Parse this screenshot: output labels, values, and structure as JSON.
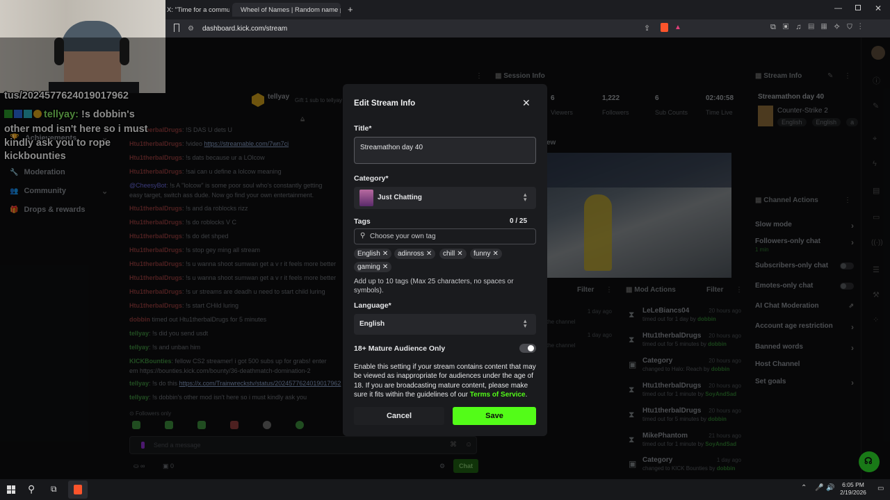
{
  "browser": {
    "tab1_title": "X: \"Time for a commu",
    "tab2_title": "Wheel of Names | Random name pick",
    "url": "dashboard.kick.com/stream"
  },
  "overlay_chat": {
    "line1": "tus/2024577624019017962",
    "username": "tellyay",
    "msg_l1": "!s dobbin's",
    "msg_l2": "other mod isn't here so i must",
    "msg_l3": "kindly ask you to rope",
    "msg_l4": "kickbounties"
  },
  "sidebar": {
    "items": [
      "Achievements",
      "Moderation",
      "Community",
      "Drops & rewards"
    ]
  },
  "chat": {
    "header_user": "tellyay",
    "header_sub": "Gift 1 sub to tellyay",
    "lines": [
      {
        "user": "Htu1therbalDrugs",
        "text": ": !S DAS U dets U"
      },
      {
        "user": "Htu1therbalDrugs",
        "text": ": !video ",
        "link": "https://streamable.com/7wn7ci"
      },
      {
        "user": "Htu1therbalDrugs",
        "text": ": !s dats because ur a LOlcow"
      },
      {
        "user": "Htu1therbalDrugs",
        "text": ": !sai can u define a lolcow meaning"
      },
      {
        "user": "@CheesyBot",
        "text": ": !s A \"lolcow\" is some poor soul who's constantly getting"
      },
      {
        "user": "",
        "text": "easy target, switch ass dude. Now go find your own entertainment."
      },
      {
        "user": "Htu1therbalDrugs",
        "text": ": !s and da roblocks rizz"
      },
      {
        "user": "Htu1therbalDrugs",
        "text": ": !s do roblocks V C"
      },
      {
        "user": "Htu1therbalDrugs",
        "text": ": !s do det shped"
      },
      {
        "user": "Htu1therbalDrugs",
        "text": ": !s stop gey ming all stream"
      },
      {
        "user": "Htu1therbalDrugs",
        "text": ": !s u wanna shoot sumwan get a v r it feels more better"
      },
      {
        "user": "Htu1therbalDrugs",
        "text": ": !s u wanna shoot sumwan get a v r it feels more better"
      },
      {
        "user": "Htu1therbalDrugs",
        "text": ": !s ur streams are deadh u need to start child luring"
      },
      {
        "user": "Htu1therbalDrugs",
        "text": ": !s start CHild luring"
      },
      {
        "user": "dobbin",
        "text": " timed out Htu1therbalDrugs for 5 minutes"
      },
      {
        "user": "tellyay",
        "text": ": !s did you send usdt"
      },
      {
        "user": "tellyay",
        "text": ": !s and unban him"
      },
      {
        "user": "KICKBounties",
        "text": ": fellow CS2 streamer! i got 500 subs up for grabs! enter"
      },
      {
        "user": "",
        "text": "em https://bounties.kick.com/bounty/36-deathmatch-domination-2"
      },
      {
        "user": "tellyay",
        "text": ": !s do this ",
        "link": "https://x.com/Trainwreckstv/status/2024577624019017962"
      },
      {
        "user": "tellyay",
        "text": ": !s dobbin's other mod isn't here so i must kindly ask you"
      }
    ],
    "followers_only": "Followers only",
    "send_placeholder": "Send a message",
    "count_left": "0",
    "count_right": "0",
    "chat_button": "Chat"
  },
  "session_info": {
    "title": "Session Info",
    "stats": [
      {
        "value": "6",
        "label": "Viewers"
      },
      {
        "value": "1,222",
        "label": "Followers"
      },
      {
        "value": "6",
        "label": "Sub Counts"
      },
      {
        "value": "02:40:58",
        "label": "Time Live"
      }
    ],
    "preview_label": "ew"
  },
  "stream_info_panel": {
    "title": "Stream Info",
    "stream_title": "Streamathon day 40",
    "category": "Counter-Strike 2",
    "tags": [
      "English",
      "English",
      "a"
    ]
  },
  "channel_actions": {
    "title": "Channel Actions",
    "items": [
      {
        "label": "Slow mode",
        "sub": ""
      },
      {
        "label": "Followers-only chat",
        "sub": "1 min"
      },
      {
        "label": "Subscribers-only chat",
        "sub": ""
      },
      {
        "label": "Emotes-only chat",
        "sub": ""
      },
      {
        "label": "AI Chat Moderation",
        "sub": ""
      },
      {
        "label": "Account age restriction",
        "sub": ""
      },
      {
        "label": "Banned words",
        "sub": ""
      },
      {
        "label": "Host Channel",
        "sub": ""
      },
      {
        "label": "Set goals",
        "sub": ""
      }
    ]
  },
  "mod_actions": {
    "title": "Mod Actions",
    "filter": "Filter",
    "left_filter": "Filter",
    "left_rows": [
      {
        "time": "1 day ago",
        "text": "the channel"
      },
      {
        "time": "1 day ago",
        "text": "the channel"
      }
    ],
    "rows": [
      {
        "title": "LeLeBiancs04",
        "pre": "timed out for 1 day by ",
        "by": "dobbin",
        "time": "20 hours ago"
      },
      {
        "title": "Htu1therbalDrugs",
        "pre": "timed out for 5 minutes by ",
        "by": "dobbin",
        "time": "20 hours ago"
      },
      {
        "title": "Category",
        "pre": "changed to Halo: Reach by ",
        "by": "dobbin",
        "time": "20 hours ago"
      },
      {
        "title": "Htu1therbalDrugs",
        "pre": "timed out for 1 minute by ",
        "by": "SoyAndSad",
        "time": "20 hours ago"
      },
      {
        "title": "Htu1therbalDrugs",
        "pre": "timed out for 5 minutes by ",
        "by": "dobbin",
        "time": "20 hours ago"
      },
      {
        "title": "MikePhantom",
        "pre": "timed out for 1 minute by ",
        "by": "SoyAndSad",
        "time": "21 hours ago"
      },
      {
        "title": "Category",
        "pre": "changed to KICK Bounties by ",
        "by": "dobbin",
        "time": "1 day ago"
      }
    ]
  },
  "modal": {
    "title": "Edit Stream Info",
    "title_label": "Title*",
    "title_value": "Streamathon day 40",
    "category_label": "Category*",
    "category_value": "Just Chatting",
    "tags_label": "Tags",
    "tags_count": "0 / 25",
    "tags_placeholder": "Choose your own tag",
    "tags": [
      "English",
      "adinross",
      "chill",
      "funny",
      "gaming"
    ],
    "tags_help": "Add up to 10 tags (Max 25 characters, no spaces or symbols).",
    "language_label": "Language*",
    "language_value": "English",
    "mature_label": "18+ Mature Audience Only",
    "mature_text": "Enable this setting if your stream contains content that may be viewed as inappropriate for audiences under the age of 18. If you are broadcasting mature content, please make sure it fits within the guidelines of our ",
    "tos_link": "Terms of Service",
    "tos_end": ".",
    "cancel": "Cancel",
    "save": "Save"
  },
  "taskbar": {
    "time": "6:05 PM",
    "date": "2/19/2026"
  },
  "colors": {
    "accent": "#53fc18",
    "modal_bg": "#1a1b1e",
    "field_bg": "#26272b"
  }
}
